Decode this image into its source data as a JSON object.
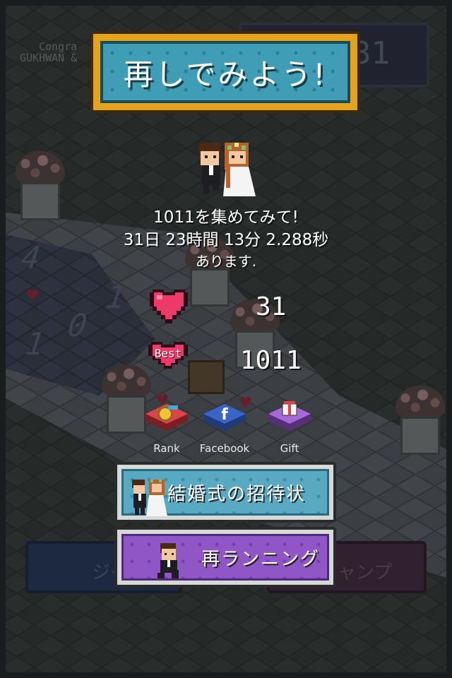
{
  "background": {
    "score_number": "31",
    "congrats_line1": "Congra",
    "congrats_line2": "GUKHWAN &",
    "floor_numbers": [
      "4",
      "1",
      "0",
      "1"
    ],
    "left_button_text": "ジャ",
    "right_button_text": "ャンプ"
  },
  "retry_button": {
    "label": "再しでみよう!"
  },
  "message": {
    "line1": "1011を集めてみて!",
    "line2": "31日 23時間 13分 2.288秒",
    "line3": "あります."
  },
  "score": {
    "current": "31",
    "best_label": "Best",
    "best": "1011"
  },
  "social": [
    {
      "name": "rank",
      "label": "Rank"
    },
    {
      "name": "facebook",
      "label": "Facebook"
    },
    {
      "name": "gift",
      "label": "Gift"
    }
  ],
  "buttons": {
    "invitation": "結婚式の招待状",
    "rerun": "再ランニング"
  },
  "colors": {
    "retry_frame": "#e3a31e",
    "retry_face": "#3f9db6",
    "heart": "#ee3a6b",
    "invitation_face": "#5aa9c2",
    "rerun_face": "#9056c5"
  }
}
